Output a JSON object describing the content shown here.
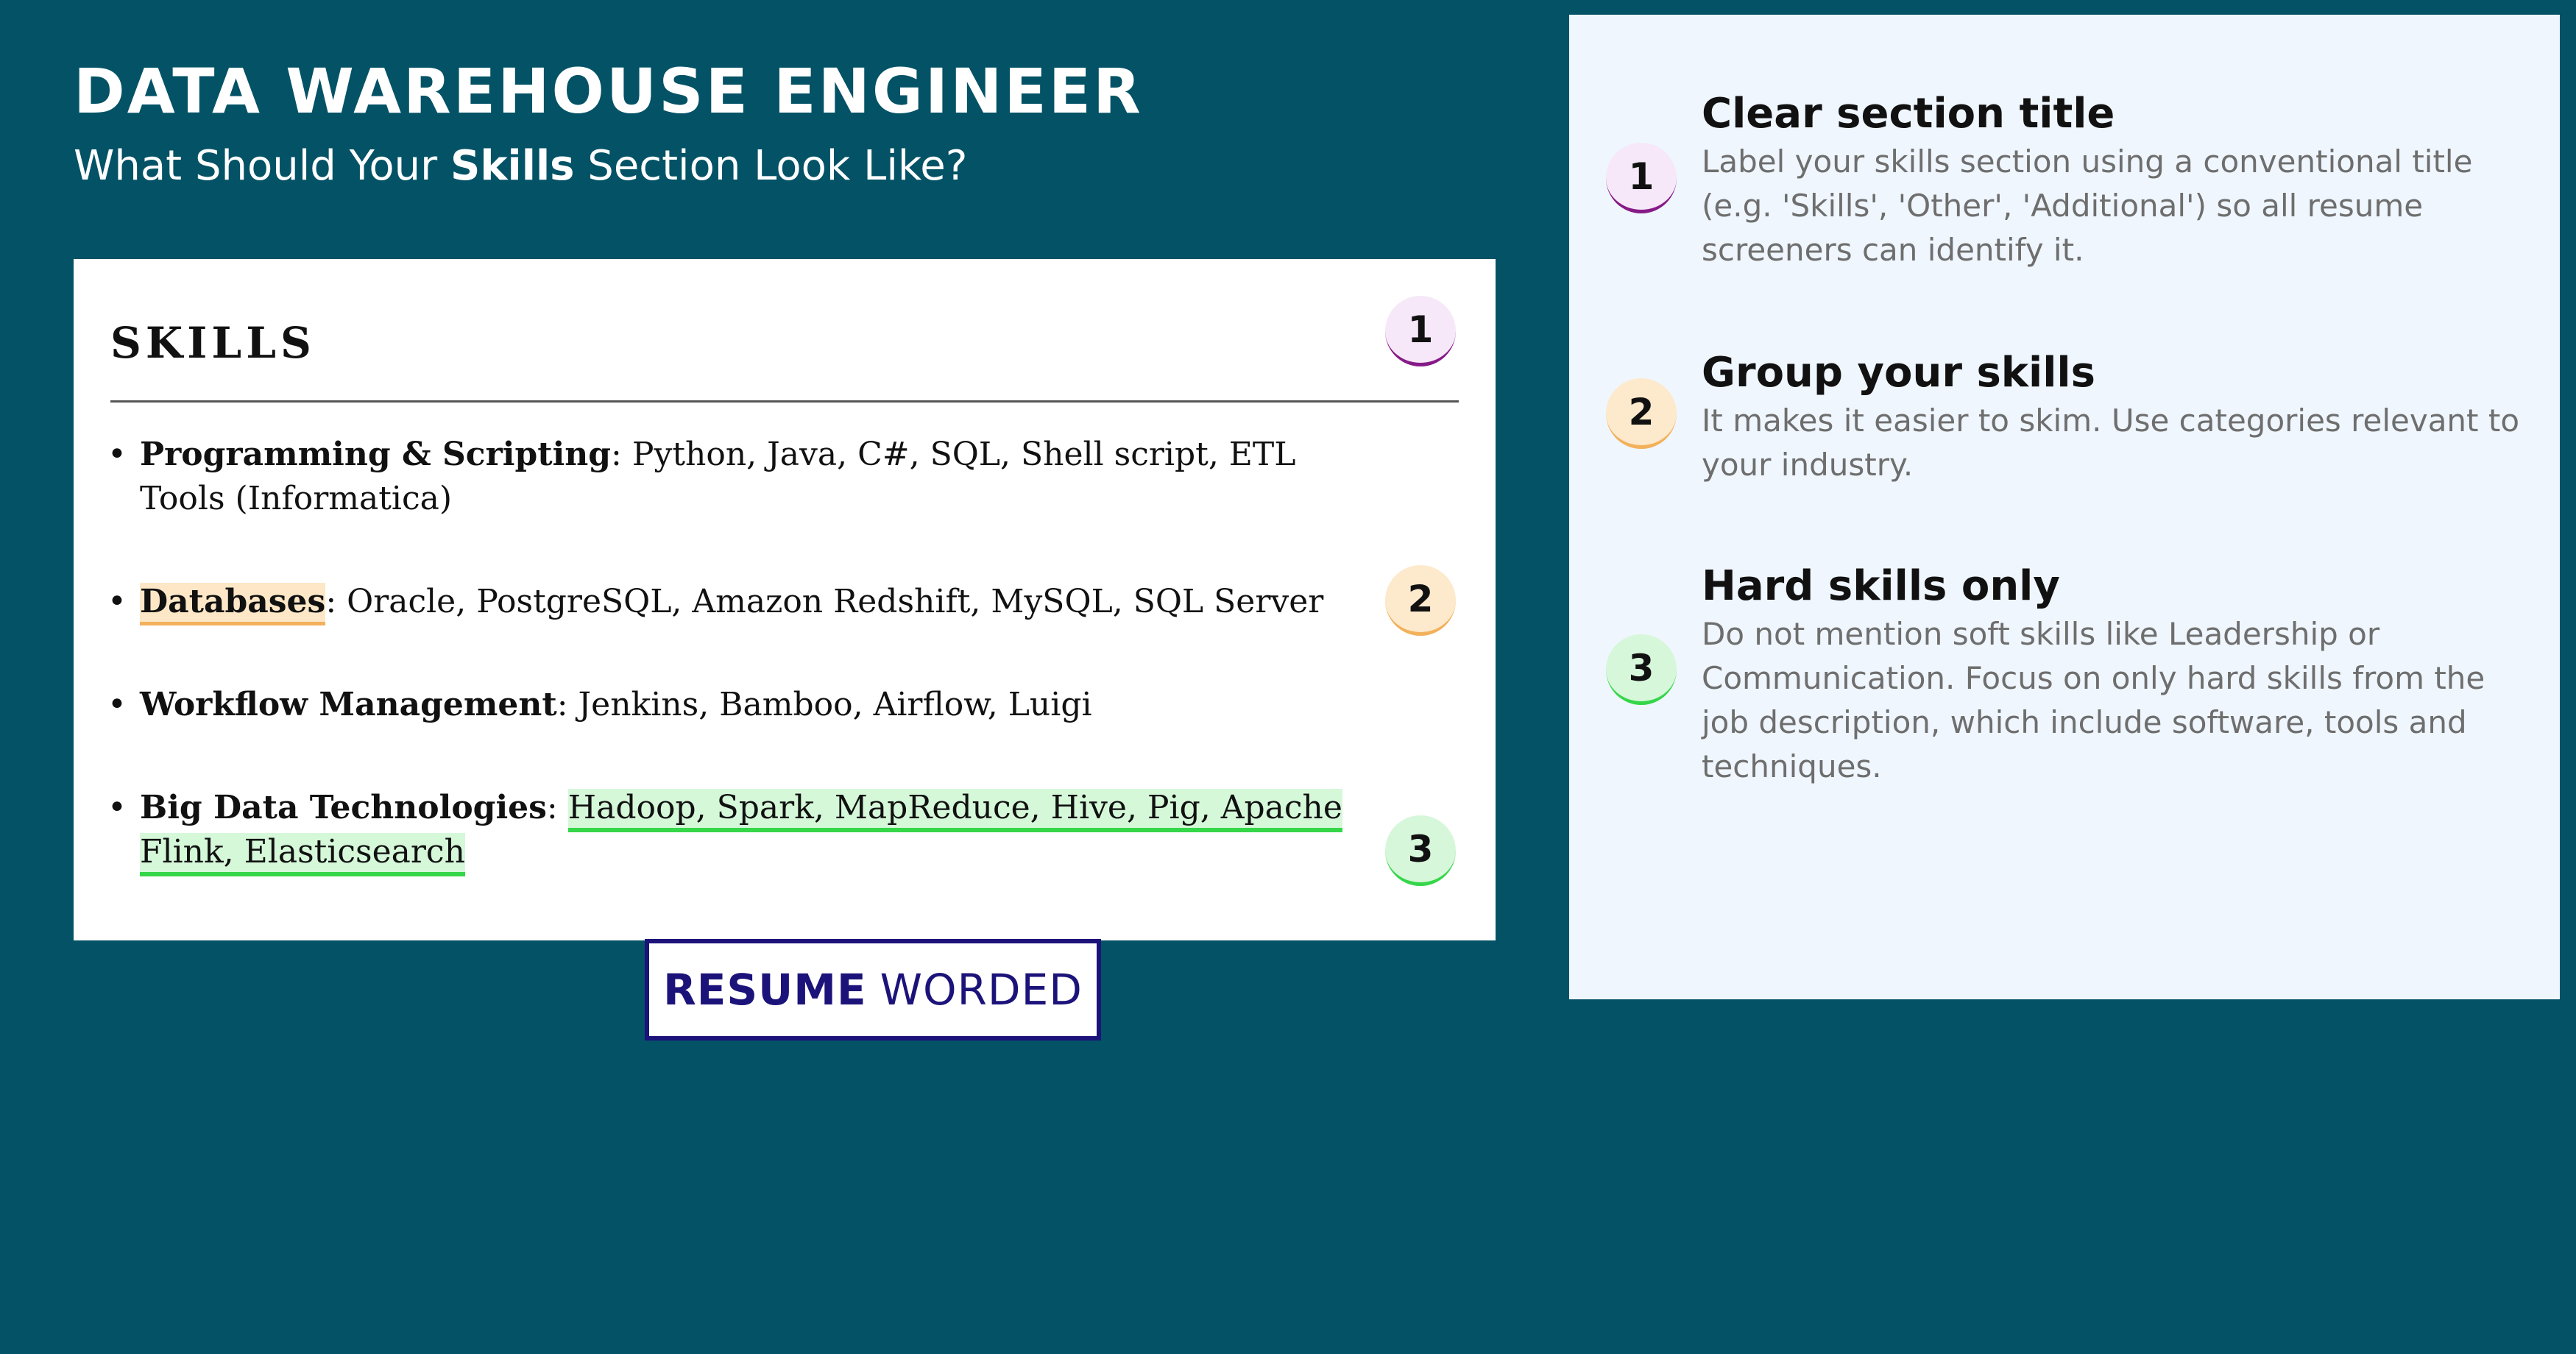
{
  "header": {
    "title": "DATA WAREHOUSE ENGINEER",
    "subtitle_prefix": "What Should Your ",
    "subtitle_bold": "Skills",
    "subtitle_suffix": " Section Look Like?"
  },
  "resume": {
    "section_heading": "SKILLS",
    "items": [
      {
        "category": "Programming & Scripting",
        "separator": ": ",
        "skills": "Python, Java, C#, SQL, Shell script, ETL Tools (Informatica)"
      },
      {
        "category": "Databases",
        "separator": ": ",
        "skills": "Oracle, PostgreSQL, Amazon Redshift, MySQL, SQL Server"
      },
      {
        "category": "Workflow Management",
        "separator": ": ",
        "skills": "Jenkins, Bamboo, Airflow, Luigi"
      },
      {
        "category": "Big Data Technologies",
        "separator": ": ",
        "skills": "Hadoop, Spark, MapReduce, Hive, Pig, Apache Flink, Elasticsearch"
      }
    ],
    "badges": [
      "1",
      "2",
      "3"
    ]
  },
  "brand": {
    "part1": "RESUME",
    "part2": "WORDED"
  },
  "tips": [
    {
      "number": "1",
      "title": "Clear section title",
      "body": "Label your skills section using a conventional title (e.g. 'Skills', 'Other', 'Additional') so all resume screeners can identify it."
    },
    {
      "number": "2",
      "title": "Group your skills",
      "body": "It makes it easier to skim. Use categories relevant to your industry."
    },
    {
      "number": "3",
      "title": "Hard skills only",
      "body": "Do not mention soft skills like Leadership or Communication. Focus on only hard skills from the job description, which include software, tools and techniques."
    }
  ],
  "colors": {
    "background": "#035266",
    "badge_1_accent": "#861a87",
    "badge_2_accent": "#f3b15c",
    "badge_3_accent": "#35d649",
    "brand": "#1c137a",
    "tips_panel": "#eff6fd"
  }
}
